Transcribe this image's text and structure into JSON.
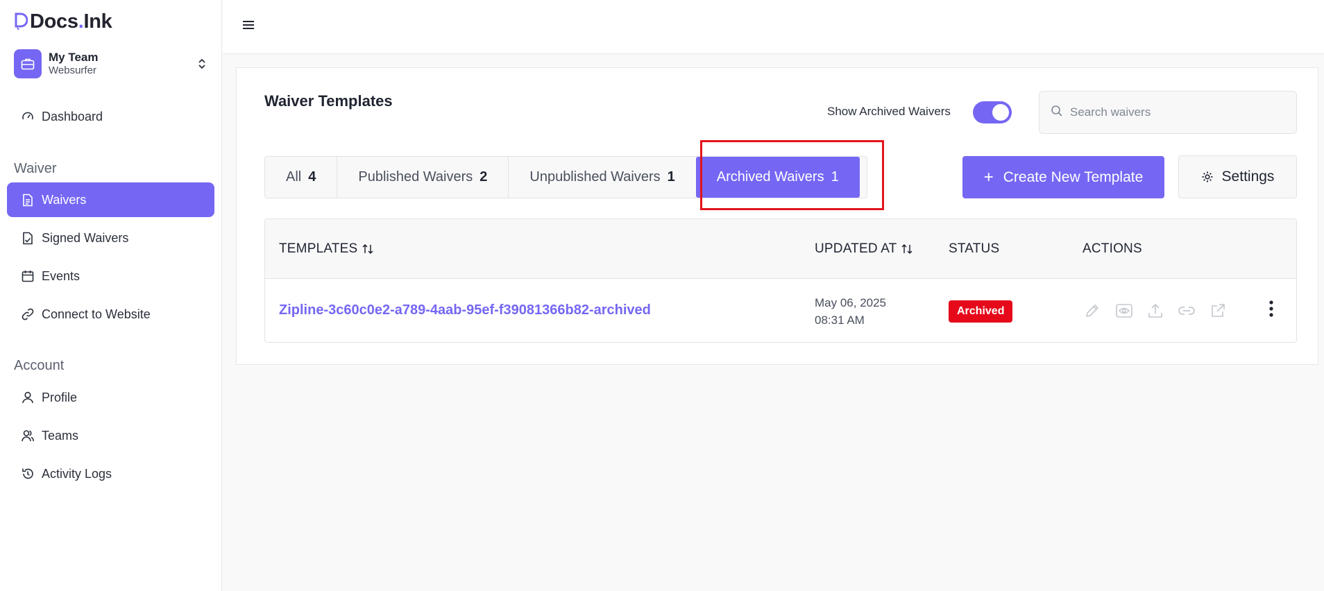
{
  "brand": {
    "name_main": "Docs",
    "name_dot": ".",
    "name_suffix": "Ink",
    "accent": "#7567f3"
  },
  "team": {
    "name": "My Team",
    "subtitle": "Websurfer"
  },
  "sidebar": {
    "dashboard": "Dashboard",
    "waiver_section": "Waiver",
    "waiver_items": [
      {
        "label": "Waivers",
        "icon": "document-icon",
        "active": true
      },
      {
        "label": "Signed Waivers",
        "icon": "signed-document-icon"
      },
      {
        "label": "Events",
        "icon": "calendar-icon"
      },
      {
        "label": "Connect to Website",
        "icon": "link-icon"
      }
    ],
    "account_section": "Account",
    "account_items": [
      {
        "label": "Profile",
        "icon": "user-icon"
      },
      {
        "label": "Teams",
        "icon": "users-icon"
      },
      {
        "label": "Activity Logs",
        "icon": "history-icon"
      }
    ]
  },
  "main": {
    "title": "Waiver Templates",
    "archived_toggle_label": "Show Archived Waivers",
    "archived_toggle_on": true,
    "search_placeholder": "Search waivers",
    "tabs": [
      {
        "label": "All",
        "count": "4"
      },
      {
        "label": "Published Waivers",
        "count": "2"
      },
      {
        "label": "Unpublished Waivers",
        "count": "1"
      },
      {
        "label": "Archived Waivers",
        "count": "1",
        "active": true
      }
    ],
    "create_button": "Create New Template",
    "settings_button": "Settings"
  },
  "table": {
    "headers": {
      "templates": "TEMPLATES",
      "updated_at": "UPDATED AT",
      "status": "STATUS",
      "actions": "ACTIONS"
    },
    "rows": [
      {
        "name": "Zipline-3c60c0e2-a789-4aab-95ef-f39081366b82-archived",
        "updated_date": "May 06, 2025",
        "updated_time": "08:31 AM",
        "status": "Archived",
        "status_color": "#e5091a"
      }
    ]
  }
}
